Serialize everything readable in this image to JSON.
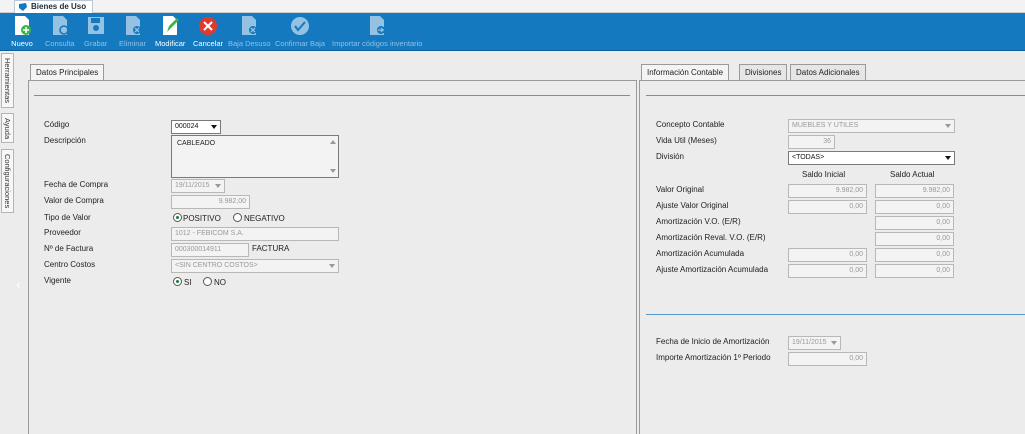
{
  "window": {
    "tab_title": "Bienes de Uso"
  },
  "toolbar": {
    "nuevo": "Nuevo",
    "consulta": "Consulta",
    "grabar": "Grabar",
    "eliminar": "Eliminar",
    "modificar": "Modificar",
    "cancelar": "Cancelar",
    "baja_desuso": "Baja Desuso",
    "confirmar_baja": "Confirmar Baja",
    "importar": "Importar códigos inventario"
  },
  "side_tabs": {
    "herramientas": "Herramientas",
    "ayuda": "Ayuda",
    "configuraciones": "Configuraciones"
  },
  "left": {
    "tab": "Datos Principales",
    "codigo": {
      "label": "Código",
      "value": "000024"
    },
    "descripcion": {
      "label": "Descripción",
      "value": "CABLEADO"
    },
    "fecha_compra": {
      "label": "Fecha de Compra",
      "value": "19/11/2015"
    },
    "valor_compra": {
      "label": "Valor de Compra",
      "value": "9.982,00"
    },
    "tipo_valor": {
      "label": "Tipo de Valor",
      "opt1": "POSITIVO",
      "opt2": "NEGATIVO"
    },
    "proveedor": {
      "label": "Proveedor",
      "value": "1012 - FEBICOM S.A."
    },
    "factura": {
      "label": "Nº de Factura",
      "value": "000300014911",
      "suffix": "FACTURA"
    },
    "centro_costos": {
      "label": "Centro Costos",
      "value": "<SIN CENTRO COSTOS>"
    },
    "vigente": {
      "label": "Vigente",
      "opt1": "SI",
      "opt2": "NO"
    }
  },
  "right": {
    "tabs": {
      "info": "Información Contable",
      "divisiones": "Divisiones",
      "adicionales": "Datos Adicionales"
    },
    "concepto": {
      "label": "Concepto Contable",
      "value": "MUEBLES Y UTILES"
    },
    "vida_util": {
      "label": "Vida Util (Meses)",
      "value": "36"
    },
    "division": {
      "label": "División",
      "value": "<TODAS>"
    },
    "col_inicial": "Saldo Inicial",
    "col_actual": "Saldo Actual",
    "valor_original": {
      "label": "Valor Original",
      "inicial": "9.982,00",
      "actual": "9.982,00"
    },
    "ajuste_valor": {
      "label": "Ajuste Valor Original",
      "inicial": "0,00",
      "actual": "0,00"
    },
    "amort_vo": {
      "label": "Amortización V.O. (E/R)",
      "actual": "0,00"
    },
    "amort_reval": {
      "label": "Amortización Reval. V.O. (E/R)",
      "actual": "0,00"
    },
    "amort_acum": {
      "label": "Amortización Acumulada",
      "inicial": "0,00",
      "actual": "0,00"
    },
    "ajuste_amort": {
      "label": "Ajuste Amortización Acumulada",
      "inicial": "0,00",
      "actual": "0,00"
    },
    "fecha_inicio": {
      "label": "Fecha de Inicio de Amortización",
      "value": "19/11/2015"
    },
    "importe_amort": {
      "label": "Importe Amortización 1º Periodo",
      "value": "0,00"
    }
  }
}
